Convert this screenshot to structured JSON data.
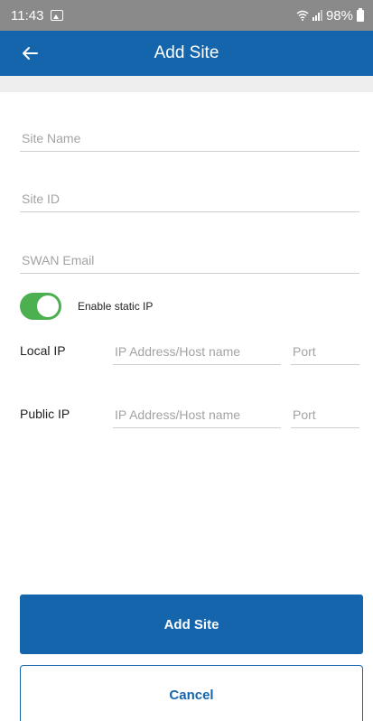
{
  "status_bar": {
    "time": "11:43",
    "battery": "98%",
    "icons": [
      "gallery-icon",
      "wifi-icon",
      "signal-icon",
      "battery-icon"
    ]
  },
  "app_bar": {
    "title": "Add Site",
    "back_icon": "back-arrow-icon",
    "color": "#1565ad"
  },
  "form": {
    "site_name": {
      "value": "",
      "placeholder": "Site Name"
    },
    "site_id": {
      "value": "",
      "placeholder": "Site ID"
    },
    "swan_email": {
      "value": "",
      "placeholder": "SWAN Email"
    },
    "static_ip": {
      "label": "Enable static IP",
      "enabled": true,
      "color": "#4caf50"
    },
    "local_ip": {
      "label": "Local IP",
      "address_placeholder": "IP Address/Host name",
      "port_placeholder": "Port"
    },
    "public_ip": {
      "label": "Public IP",
      "address_placeholder": "IP Address/Host name",
      "port_placeholder": "Port"
    }
  },
  "actions": {
    "add_label": "Add Site",
    "cancel_label": "Cancel"
  }
}
